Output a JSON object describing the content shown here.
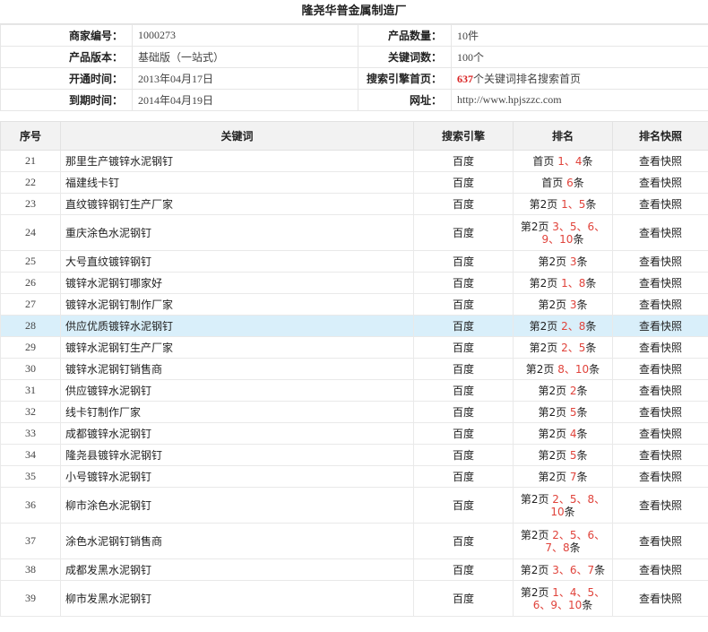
{
  "title": "隆尧华普金属制造厂",
  "info": [
    {
      "l1": "商家编号：",
      "v1": "1000273",
      "l2": "产品数量：",
      "v2": "10件"
    },
    {
      "l1": "产品版本：",
      "v1": "基础版（一站式）",
      "l2": "关键词数：",
      "v2": "100个"
    },
    {
      "l1": "开通时间：",
      "v1": "2013年04月17日",
      "l2": "搜索引擎首页：",
      "v2_red": "637",
      "v2": "个关键词排名搜索首页"
    },
    {
      "l1": "到期时间：",
      "v1": "2014年04月19日",
      "l2": "网址：",
      "v2": "http://www.hpjszzc.com"
    }
  ],
  "headers": {
    "no": "序号",
    "keyword": "关键词",
    "engine": "搜索引擎",
    "rank": "排名",
    "snapshot": "排名快照"
  },
  "highlight_color": "#d9effa",
  "rows": [
    {
      "no": "21",
      "keyword": "那里生产镀锌水泥钢钉",
      "engine": "百度",
      "page": "首页",
      "positions": "1、4",
      "suffix": "条",
      "snapshot": "查看快照"
    },
    {
      "no": "22",
      "keyword": "福建线卡钉",
      "engine": "百度",
      "page": "首页",
      "positions": "6",
      "suffix": "条",
      "snapshot": "查看快照"
    },
    {
      "no": "23",
      "keyword": "直纹镀锌钢钉生产厂家",
      "engine": "百度",
      "page": "第2页",
      "positions": "1、5",
      "suffix": "条",
      "snapshot": "查看快照"
    },
    {
      "no": "24",
      "keyword": "重庆涂色水泥钢钉",
      "engine": "百度",
      "page": "第2页",
      "positions": "3、5、6、9、10",
      "suffix": "条",
      "snapshot": "查看快照"
    },
    {
      "no": "25",
      "keyword": "大号直纹镀锌钢钉",
      "engine": "百度",
      "page": "第2页",
      "positions": "3",
      "suffix": "条",
      "snapshot": "查看快照"
    },
    {
      "no": "26",
      "keyword": "镀锌水泥钢钉哪家好",
      "engine": "百度",
      "page": "第2页",
      "positions": "1、8",
      "suffix": "条",
      "snapshot": "查看快照"
    },
    {
      "no": "27",
      "keyword": "镀锌水泥钢钉制作厂家",
      "engine": "百度",
      "page": "第2页",
      "positions": "3",
      "suffix": "条",
      "snapshot": "查看快照"
    },
    {
      "no": "28",
      "keyword": "供应优质镀锌水泥钢钉",
      "engine": "百度",
      "page": "第2页",
      "positions": "2、8",
      "suffix": "条",
      "snapshot": "查看快照"
    },
    {
      "no": "29",
      "keyword": "镀锌水泥钢钉生产厂家",
      "engine": "百度",
      "page": "第2页",
      "positions": "2、5",
      "suffix": "条",
      "snapshot": "查看快照"
    },
    {
      "no": "30",
      "keyword": "镀锌水泥钢钉销售商",
      "engine": "百度",
      "page": "第2页",
      "positions": "8、10",
      "suffix": "条",
      "snapshot": "查看快照"
    },
    {
      "no": "31",
      "keyword": "供应镀锌水泥钢钉",
      "engine": "百度",
      "page": "第2页",
      "positions": "2",
      "suffix": "条",
      "snapshot": "查看快照"
    },
    {
      "no": "32",
      "keyword": "线卡钉制作厂家",
      "engine": "百度",
      "page": "第2页",
      "positions": "5",
      "suffix": "条",
      "snapshot": "查看快照"
    },
    {
      "no": "33",
      "keyword": "成都镀锌水泥钢钉",
      "engine": "百度",
      "page": "第2页",
      "positions": "4",
      "suffix": "条",
      "snapshot": "查看快照"
    },
    {
      "no": "34",
      "keyword": "隆尧县镀锌水泥钢钉",
      "engine": "百度",
      "page": "第2页",
      "positions": "5",
      "suffix": "条",
      "snapshot": "查看快照"
    },
    {
      "no": "35",
      "keyword": "小号镀锌水泥钢钉",
      "engine": "百度",
      "page": "第2页",
      "positions": "7",
      "suffix": "条",
      "snapshot": "查看快照"
    },
    {
      "no": "36",
      "keyword": "柳市涂色水泥钢钉",
      "engine": "百度",
      "page": "第2页",
      "positions": "2、5、8、10",
      "suffix": "条",
      "snapshot": "查看快照"
    },
    {
      "no": "37",
      "keyword": "涂色水泥钢钉销售商",
      "engine": "百度",
      "page": "第2页",
      "positions": "2、5、6、7、8",
      "suffix": "条",
      "snapshot": "查看快照"
    },
    {
      "no": "38",
      "keyword": "成都发黑水泥钢钉",
      "engine": "百度",
      "page": "第2页",
      "positions": "3、6、7",
      "suffix": "条",
      "snapshot": "查看快照"
    },
    {
      "no": "39",
      "keyword": "柳市发黑水泥钢钉",
      "engine": "百度",
      "page": "第2页",
      "positions": "1、4、5、6、9、10",
      "suffix": "条",
      "snapshot": "查看快照"
    }
  ]
}
